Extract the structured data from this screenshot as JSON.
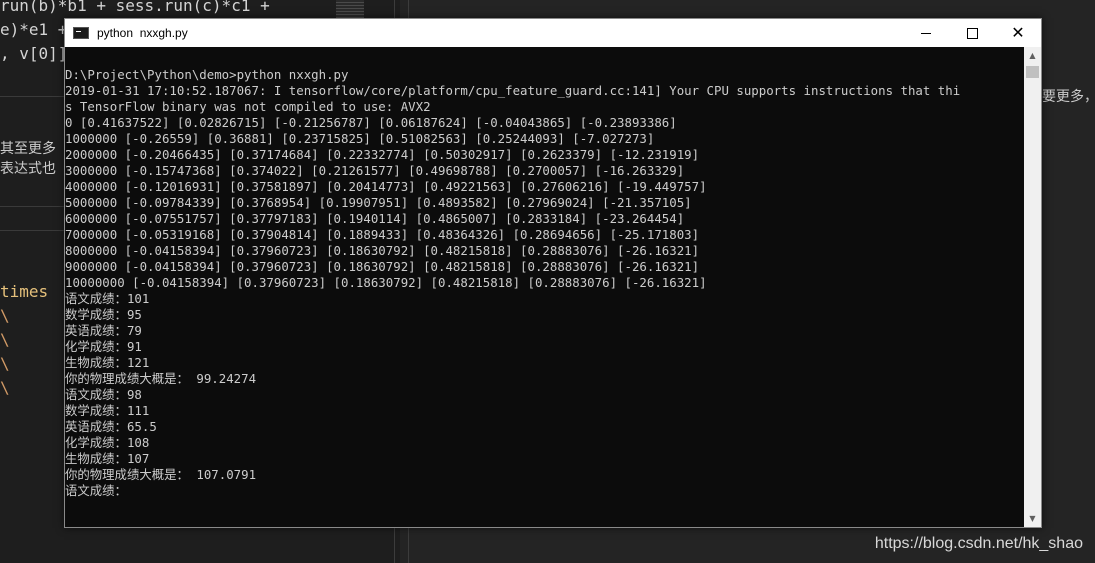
{
  "editor": {
    "lines": [
      "run(b)*b1 + sess.run(c)*c1 +",
      "e)*e1 +",
      ", v[0]]"
    ],
    "fragments": [
      "其至更多",
      "表达式也"
    ],
    "times_label": "times",
    "backslash": "\\"
  },
  "window": {
    "title": "python  nxxgh.py",
    "minimize_label": "",
    "maximize_label": "",
    "close_label": "✕"
  },
  "console": {
    "lines": [
      "D:\\Project\\Python\\demo>python nxxgh.py",
      "2019-01-31 17:10:52.187067: I tensorflow/core/platform/cpu_feature_guard.cc:141] Your CPU supports instructions that thi",
      "s TensorFlow binary was not compiled to use: AVX2",
      "0 [0.41637522] [0.02826715] [-0.21256787] [0.06187624] [-0.04043865] [-0.23893386]",
      "1000000 [-0.26559] [0.36881] [0.23715825] [0.51082563] [0.25244093] [-7.027273]",
      "2000000 [-0.20466435] [0.37174684] [0.22332774] [0.50302917] [0.2623379] [-12.231919]",
      "3000000 [-0.15747368] [0.374022] [0.21261577] [0.49698788] [0.2700057] [-16.263329]",
      "4000000 [-0.12016931] [0.37581897] [0.20414773] [0.49221563] [0.27606216] [-19.449757]",
      "5000000 [-0.09784339] [0.3768954] [0.19907951] [0.4893582] [0.27969024] [-21.357105]",
      "6000000 [-0.07551757] [0.37797183] [0.1940114] [0.4865007] [0.2833184] [-23.264454]",
      "7000000 [-0.05319168] [0.37904814] [0.1889433] [0.48364326] [0.28694656] [-25.171803]",
      "8000000 [-0.04158394] [0.37960723] [0.18630792] [0.48215818] [0.28883076] [-26.16321]",
      "9000000 [-0.04158394] [0.37960723] [0.18630792] [0.48215818] [0.28883076] [-26.16321]",
      "10000000 [-0.04158394] [0.37960723] [0.18630792] [0.48215818] [0.28883076] [-26.16321]",
      "语文成绩：101",
      "数学成绩：95",
      "英语成绩：79",
      "化学成绩：91",
      "生物成绩：121",
      "你的物理成绩大概是： 99.24274",
      "语文成绩：98",
      "数学成绩：111",
      "英语成绩：65.5",
      "化学成绩：108",
      "生物成绩：107",
      "你的物理成绩大概是： 107.0791",
      "语文成绩："
    ]
  },
  "overflow_text": "要更多，相",
  "watermark": "https://blog.csdn.net/hk_shao",
  "colors": {
    "console_bg": "#0c0c0c",
    "console_text": "#cccccc",
    "titlebar_bg": "#ffffff",
    "editor_bg": "#1e1e1e"
  }
}
